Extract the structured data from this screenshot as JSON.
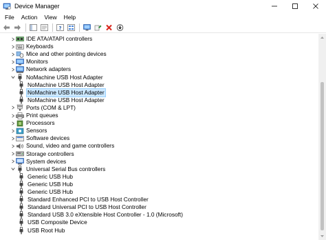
{
  "window": {
    "title": "Device Manager",
    "minimize_glyph": "—",
    "maximize_glyph": "☐",
    "close_glyph": "✕"
  },
  "menu": [
    "File",
    "Action",
    "View",
    "Help"
  ],
  "toolbar": [
    "back-arrow-icon",
    "forward-arrow-icon",
    "show-hide-console-tree-icon",
    "properties-icon",
    "help-icon",
    "show-hidden-devices-icon",
    "monitor-icon",
    "update-driver-icon",
    "uninstall-device-icon",
    "scan-for-hardware-changes-icon"
  ],
  "tree": [
    {
      "label": "IDE ATA/ATAPI controllers",
      "level": 1,
      "state": "collapsed",
      "icon": "ide-controller-icon"
    },
    {
      "label": "Keyboards",
      "level": 1,
      "state": "collapsed",
      "icon": "keyboard-icon"
    },
    {
      "label": "Mice and other pointing devices",
      "level": 1,
      "state": "collapsed",
      "icon": "mouse-icon"
    },
    {
      "label": "Monitors",
      "level": 1,
      "state": "collapsed",
      "icon": "monitor-icon"
    },
    {
      "label": "Network adapters",
      "level": 1,
      "state": "collapsed",
      "icon": "network-adapter-icon"
    },
    {
      "label": "NoMachine USB Host Adapter",
      "level": 1,
      "state": "expanded",
      "icon": "usb-plug-icon"
    },
    {
      "label": "NoMachine USB Host Adapter",
      "level": 2,
      "state": "leaf",
      "icon": "usb-plug-icon"
    },
    {
      "label": "NoMachine USB Host Adapter",
      "level": 2,
      "state": "leaf",
      "icon": "usb-plug-icon",
      "selected": true
    },
    {
      "label": "NoMachine USB Host Adapter",
      "level": 2,
      "state": "leaf",
      "icon": "usb-plug-icon"
    },
    {
      "label": "Ports (COM & LPT)",
      "level": 1,
      "state": "collapsed",
      "icon": "port-icon"
    },
    {
      "label": "Print queues",
      "level": 1,
      "state": "collapsed",
      "icon": "printer-icon"
    },
    {
      "label": "Processors",
      "level": 1,
      "state": "collapsed",
      "icon": "processor-icon"
    },
    {
      "label": "Sensors",
      "level": 1,
      "state": "collapsed",
      "icon": "sensor-icon"
    },
    {
      "label": "Software devices",
      "level": 1,
      "state": "collapsed",
      "icon": "software-device-icon"
    },
    {
      "label": "Sound, video and game controllers",
      "level": 1,
      "state": "collapsed",
      "icon": "speaker-icon"
    },
    {
      "label": "Storage controllers",
      "level": 1,
      "state": "collapsed",
      "icon": "storage-controller-icon"
    },
    {
      "label": "System devices",
      "level": 1,
      "state": "collapsed",
      "icon": "system-device-icon"
    },
    {
      "label": "Universal Serial Bus controllers",
      "level": 1,
      "state": "expanded",
      "icon": "usb-plug-icon"
    },
    {
      "label": "Generic USB Hub",
      "level": 2,
      "state": "leaf",
      "icon": "usb-plug-icon"
    },
    {
      "label": "Generic USB Hub",
      "level": 2,
      "state": "leaf",
      "icon": "usb-plug-icon"
    },
    {
      "label": "Generic USB Hub",
      "level": 2,
      "state": "leaf",
      "icon": "usb-plug-icon"
    },
    {
      "label": "Standard Enhanced PCI to USB Host Controller",
      "level": 2,
      "state": "leaf",
      "icon": "usb-plug-icon"
    },
    {
      "label": "Standard Universal PCI to USB Host Controller",
      "level": 2,
      "state": "leaf",
      "icon": "usb-plug-icon"
    },
    {
      "label": "Standard USB 3.0 eXtensible Host Controller - 1.0 (Microsoft)",
      "level": 2,
      "state": "leaf",
      "icon": "usb-plug-icon"
    },
    {
      "label": "USB Composite Device",
      "level": 2,
      "state": "leaf",
      "icon": "usb-plug-icon"
    },
    {
      "label": "USB Root Hub",
      "level": 2,
      "state": "leaf",
      "icon": "usb-plug-icon"
    }
  ],
  "colors": {
    "selection_bg": "#cce8ff",
    "selection_border": "#99d1ff",
    "delete_red": "#d9261c",
    "update_green": "#2e8b3a"
  }
}
